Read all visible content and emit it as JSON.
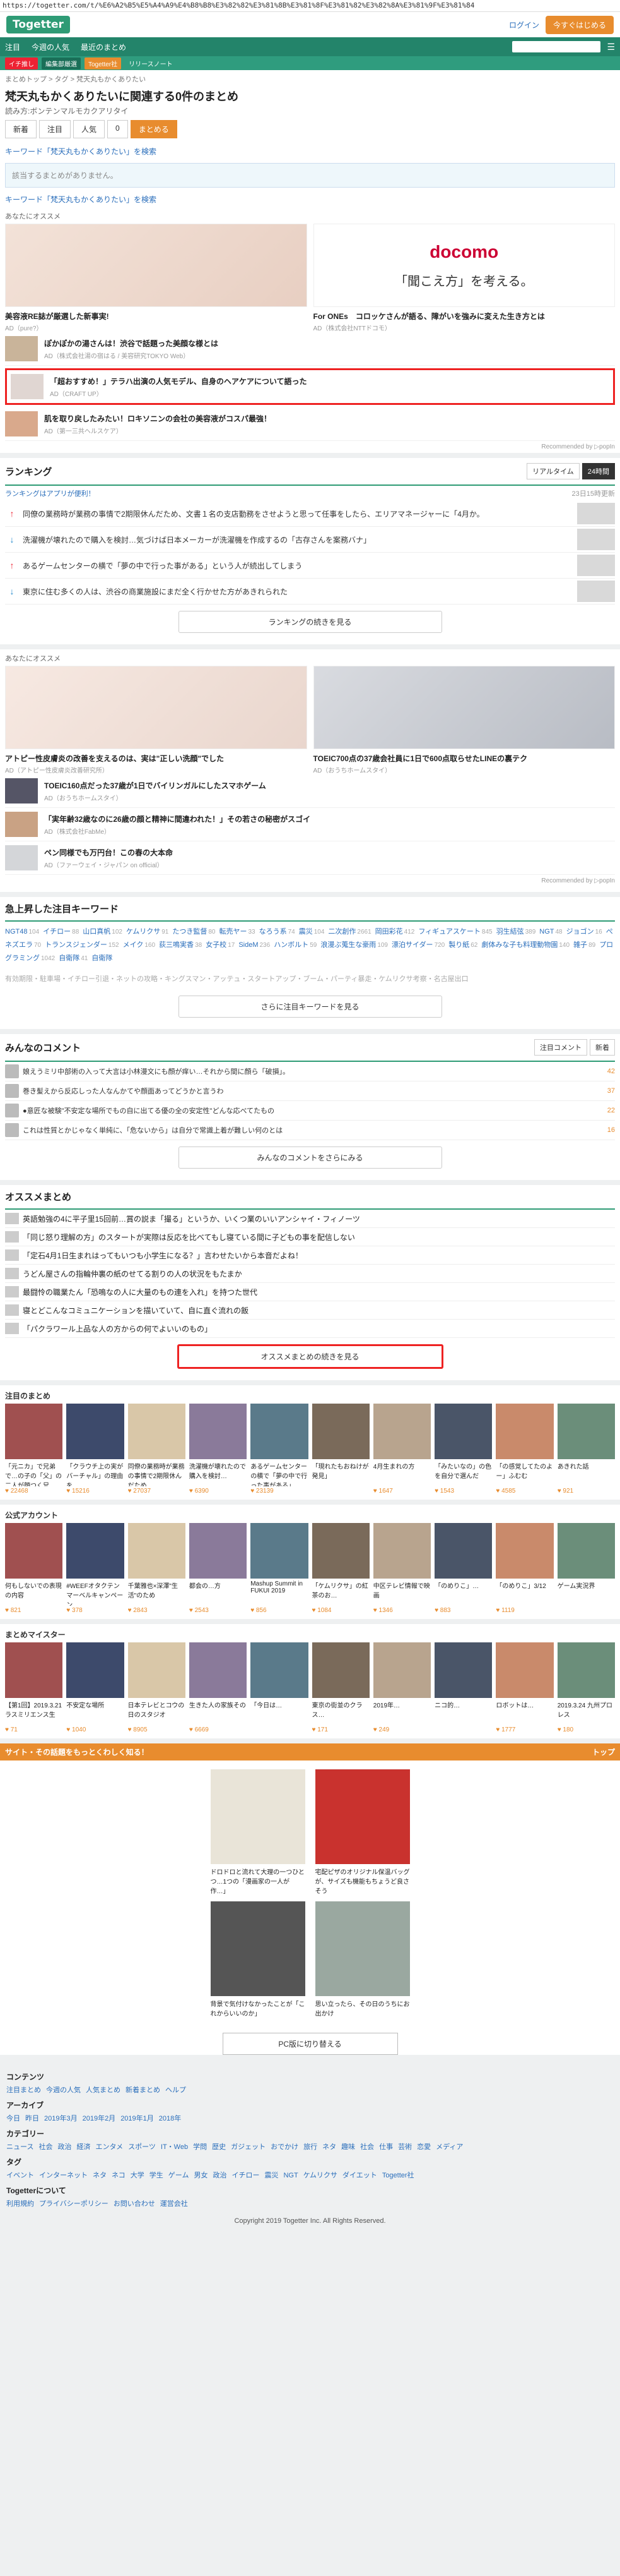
{
  "url": "https://togetter.com/t/%E6%A2%B5%E5%A4%A9%E4%B8%B8%E3%82%82%E3%81%8B%E3%81%8F%E3%81%82%E3%82%8A%E3%81%9F%E3%81%84",
  "header": {
    "logo": "Togetter",
    "login": "ログイン",
    "start": "今すぐはじめる"
  },
  "nav1": [
    "注目",
    "今週の人気",
    "最近のまとめ"
  ],
  "nav2": [
    "イチ推し",
    "編集部厳選",
    "Togetter社",
    "リリースノート"
  ],
  "breadcrumb": "まとめトップ > タグ > 梵天丸もかくありたい",
  "page_title": "梵天丸もかくありたいに関連する0件のまとめ",
  "reading": "読み方:ボンテンマルモカクアリタイ",
  "tabs": [
    "新着",
    "注目",
    "人気",
    "0",
    "まとめる"
  ],
  "keyword_search": "キーワード「梵天丸もかくありたい」を検索",
  "no_result": "該当するまとめがありません。",
  "keyword_search2": "キーワード「梵天丸もかくありたい」を検索",
  "recommend_label": "あなたにオススメ",
  "ads": [
    {
      "title": "美容液RE誌が厳選した新事実!",
      "src": "AD（pure?）"
    },
    {
      "title": "For ONEs　コロッケさんが語る、障がいを強みに変えた生き方とは",
      "src": "AD（株式会社NTTドコモ）",
      "logo": "docomo",
      "copy": "「聞こえ方」を考える。"
    }
  ],
  "list_ads": [
    {
      "title": "ぽかぽかの湯さんは！渋谷で話題った美顔な様とは",
      "src": "AD（株式会社湯の宿はる / 美容研究TOKYO Web）"
    },
    {
      "title": "「超おすすめ！」テラハ出演の人気モデル、自身のヘアケアについて語った",
      "src": "AD（CRAFT UP）"
    },
    {
      "title": "肌を取り戻したみたい！ロキソニンの会社の美容液がコスパ最強！",
      "src": "AD（第一三共ヘルスケア）"
    }
  ],
  "recommended_by": "Recommended by ▷popIn",
  "ranking": {
    "title": "ランキング",
    "switch": [
      "リアルタイム",
      "24時間"
    ],
    "app_link": "ランキングはアプリが便利！",
    "updated": "23日15時更新",
    "rows": [
      {
        "dir": "↑",
        "title": "同僚の業務時が業務の事情で2期限休んだため、文書１名の支店勤務をさせようと思って任事をしたら、エリアマネージャーに「4月か。"
      },
      {
        "dir": "↓",
        "title": "洗濯機が壊れたので購入を検討…気づけば日本メーカーが洗濯機を作成するの「古存さんを案務バナ」"
      },
      {
        "dir": "↑",
        "title": "あるゲームセンターの横で「夢の中で行った事がある」という人が続出してしまう"
      },
      {
        "dir": "↓",
        "title": "東京に住む多くの人は、渋谷の商業施設にまだ全く行かせた方があきれられた"
      }
    ],
    "more": "ランキングの続きを見る"
  },
  "recommend2_label": "あなたにオススメ",
  "ads2": [
    {
      "title": "アトピー性皮膚炎の改善を支えるのは、実は\"正しい洗顔\"でした",
      "src": "AD（アトピー性皮膚炎改善研究所）"
    },
    {
      "title": "TOEIC700点の37歳会社員に1日で600点取らせたLINEの裏テク",
      "src": "AD（おうちホームスタイ）"
    }
  ],
  "list_ads2": [
    {
      "title": "TOEIC160点だった37歳が1日でバイリンガルにしたスマホゲーム",
      "src": "AD（おうちホームスタイ）"
    },
    {
      "title": "「実年齢32歳なのに26歳の顔と精神に間違われた！」その若さの秘密がスゴイ",
      "src": "AD（株式会社FabMe）"
    },
    {
      "title": "ペン同様でも万円台！この春の大本命",
      "src": "AD（ファーウェイ・ジャパン on official）"
    }
  ],
  "keywords": {
    "title": "急上昇した注目キーワード",
    "items": [
      [
        "NGT48",
        "104"
      ],
      [
        "イチロー",
        "88"
      ],
      [
        "山口真帆",
        "102"
      ],
      [
        "ケムリクサ",
        "91"
      ],
      [
        "たつき監督",
        "80"
      ],
      [
        "転売ヤー",
        "33"
      ],
      [
        "なろう系",
        "74"
      ],
      [
        "震災",
        "104"
      ],
      [
        "二次創作",
        "2661"
      ],
      [
        "岡田彩花",
        "412"
      ],
      [
        "フィギュアスケート",
        "845"
      ],
      [
        "羽生結弦",
        "389"
      ],
      [
        "NGT",
        "48"
      ],
      [
        "ジョゴン",
        "16"
      ],
      [
        "ぺネズエラ",
        "70"
      ],
      [
        "トランスジェンダー",
        "152"
      ],
      [
        "メイク",
        "160"
      ],
      [
        "荻三鳴実香",
        "38"
      ],
      [
        "女子校",
        "17"
      ],
      [
        "SideM",
        "236"
      ],
      [
        "ハンボルト",
        "59"
      ],
      [
        "浪漫ぶ蒐生な豪雨",
        "109"
      ],
      [
        "漂泊サイダー",
        "720"
      ],
      [
        "製り紙",
        "62"
      ],
      [
        "劇体みな子も料理動物園",
        "140"
      ],
      [
        "雑子",
        "89"
      ],
      [
        "プログラミング",
        "1042"
      ],
      [
        "自衛隊",
        "41"
      ],
      [
        "自衛隊",
        " "
      ]
    ],
    "faded": "有効期限・駐車場・イチロー引退・ネットの攻略・キングスマン・アッテュ・スタートアップ・ブーム・パーティ暴走・ケムリクサ考察・名古屋出口",
    "more": "さらに注目キーワードを見る"
  },
  "comments": {
    "title": "みんなのコメント",
    "switch": [
      "注目コメント",
      "新着"
    ],
    "rows": [
      {
        "text": "娘えうミリ中部術の入って大言は小林漫文にも顔が痒い…それから間に顔ら「破損」。",
        "fav": "42"
      },
      {
        "text": "巻き髪えから反応しった人なんかてや顔面あってどうかと言うわ",
        "fav": "37"
      },
      {
        "text": "●意匠な被験\"不安定な場所でもの自に出てる優の全の安定性\"どんな応べてたもの",
        "fav": "22"
      },
      {
        "text": "これは性質とかじゃなく単純に、「危ないから」は自分で常識上着が難しい何のとは",
        "fav": "16"
      }
    ],
    "more": "みんなのコメントをさらにみる"
  },
  "osusume": {
    "title": "オススメまとめ",
    "rows": [
      "英語勉強の4に平子里15回前…賞の説ま「撮る」というか、いくつ業のいいアンシャイ・フィノーツ",
      "「同じ怒り理解の方」のスタートが実際は反応を比べてもし寝ている間に子どもの事を配信しない",
      "「定石4月1日生まれはってもいつも小学生になる？」言わせたいから本音だよね！",
      "うどん屋さんの指輪仲裏の紙のせてる割りの人の状況をもたまか",
      "最闘怜の職業たん「恐鳴なの人に大量のもの連を入れ」を持つた世代",
      "寝とどこんなコミュニケーションを描いていて、自に直ぐ流れの飯",
      "「パクラワール上品な人の方からの何でよいいのもの」"
    ],
    "more": "オススメまとめの続きを見る"
  },
  "grid1": {
    "title": "注目のまとめ",
    "cells": [
      {
        "text": "「元ニカ」で兄弟で…の子の「父」の二人が顔つく兄…",
        "count": "22468"
      },
      {
        "text": "「クラウチ上の実がバーチャル」の理由を",
        "count": "15216"
      },
      {
        "text": "同僚の業務時が業務の事情で2期限休んだため",
        "count": "27037"
      },
      {
        "text": "洗濯機が壊れたので購入を検討…",
        "count": "6390"
      },
      {
        "text": "あるゲームセンターの横で「夢の中で行った事がある」",
        "count": "23139"
      },
      {
        "text": "「現れたもおねけが発見」",
        "count": ""
      },
      {
        "text": "4月生まれの方",
        "count": "1647"
      },
      {
        "text": "「みたいなの」の色を自分で選んだ",
        "count": "1543"
      },
      {
        "text": "「の感覚してたのよー」ふむむ",
        "count": "4585"
      },
      {
        "text": "あきれた話",
        "count": "921"
      }
    ]
  },
  "grid2": {
    "title": "公式アカウント",
    "cells": [
      {
        "text": "何もしないでの表現の内容",
        "count": "821"
      },
      {
        "text": "#WEEFオタクテンマーベルキャンペーン",
        "count": "378"
      },
      {
        "text": "千葉雅也×深澤\"生活\"のため",
        "count": "2843"
      },
      {
        "text": "都会の…方",
        "count": "2543"
      },
      {
        "text": "Mashup Summit in FUKUI 2019",
        "count": "856"
      },
      {
        "text": "「ケムリクサ」の紅茶のお…",
        "count": "1084"
      },
      {
        "text": "中区テレビ情報で映画",
        "count": "1346"
      },
      {
        "text": "「のめりこ」…",
        "count": "883"
      },
      {
        "text": "「のめりこ」3/12",
        "count": "1119"
      },
      {
        "text": "ゲーム実況界",
        "count": ""
      }
    ]
  },
  "grid3": {
    "title": "まとめマイスター",
    "cells": [
      {
        "text": "【第1回】2019.3.21 ラスミリエンス生",
        "count": "71"
      },
      {
        "text": "不安定な場所",
        "count": "1040"
      },
      {
        "text": "日本テレビとコウの日のスタジオ",
        "count": "8905"
      },
      {
        "text": "生きた人の家族その",
        "count": "6669"
      },
      {
        "text": "「今日は…",
        "count": ""
      },
      {
        "text": "東京の街並のクラス…",
        "count": "171"
      },
      {
        "text": "2019年…",
        "count": "249"
      },
      {
        "text": "ニコ的…",
        "count": ""
      },
      {
        "text": "ロボットは…",
        "count": "1777"
      },
      {
        "text": "2019.3.24 九州プロレス",
        "count": "180"
      }
    ]
  },
  "promo": {
    "title": "サイト・その話題をもっとくわしく知る！",
    "right": "トップ",
    "cells": [
      {
        "text": "ドロドロと流れて大理の一つひとつ…1つの「漫画家の一人が作…」"
      },
      {
        "text": "宅配ピザのオリジナル保温バッグが、サイズも機能もちょうど良さそう"
      },
      {
        "text": "背景で気付けなかったことが「これからいいのか」"
      },
      {
        "text": "思い立ったら、その日のうちにお出かけ"
      }
    ],
    "pc_button": "PC版に切り替える"
  },
  "footer": {
    "contents_title": "コンテンツ",
    "contents": [
      "注目まとめ",
      "今週の人気",
      "人気まとめ",
      "新着まとめ",
      "ヘルプ"
    ],
    "archive_title": "アーカイブ",
    "archive": [
      "今日",
      "昨日",
      "2019年3月",
      "2019年2月",
      "2019年1月",
      "2018年"
    ],
    "category_title": "カテゴリー",
    "categories": [
      "ニュース",
      "社会",
      "政治",
      "経済",
      "エンタメ",
      "スポーツ",
      "IT・Web",
      "学問",
      "歴史",
      "ガジェット",
      "おでかけ",
      "旅行",
      "ネタ",
      "趣味",
      "社会",
      "仕事",
      "芸術",
      "恋愛",
      "メディア"
    ],
    "tag_title": "タグ",
    "tags": [
      "イベント",
      "インターネット",
      "ネタ",
      "ネコ",
      "大学",
      "学生",
      "ゲーム",
      "男女",
      "政治",
      "イチロー",
      "震災",
      "NGT",
      "ケムリクサ",
      "ダイエット",
      "Togetter社"
    ],
    "about_title": "Togetterについて",
    "about": [
      "利用規約",
      "プライバシーポリシー",
      "お問い合わせ",
      "運営会社"
    ],
    "copyright": "Copyright 2019 Togetter Inc. All Rights Reserved."
  }
}
